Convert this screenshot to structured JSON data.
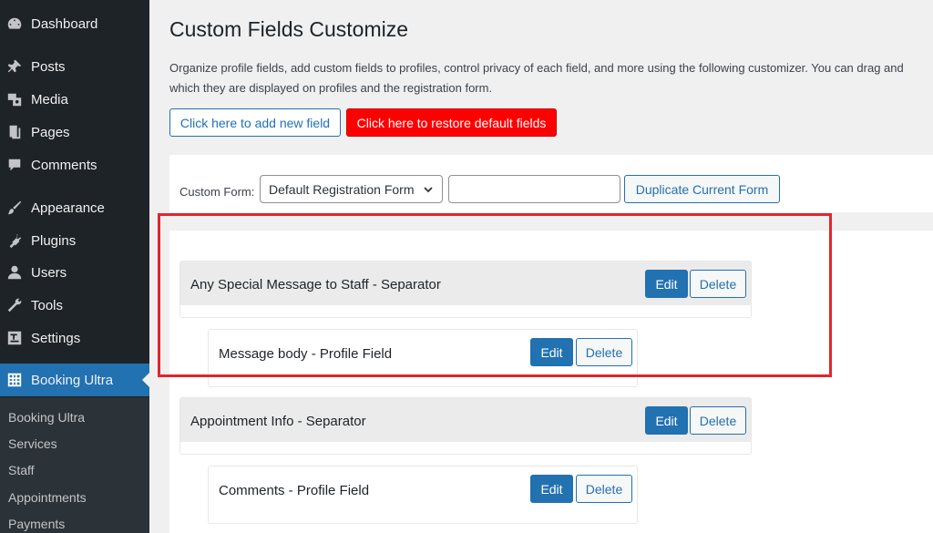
{
  "sidebar": {
    "items": [
      {
        "label": "Dashboard",
        "icon": "dashboard-icon"
      },
      {
        "label": "Posts",
        "icon": "pin-icon"
      },
      {
        "label": "Media",
        "icon": "media-icon"
      },
      {
        "label": "Pages",
        "icon": "pages-icon"
      },
      {
        "label": "Comments",
        "icon": "comment-icon"
      },
      {
        "label": "Appearance",
        "icon": "brush-icon"
      },
      {
        "label": "Plugins",
        "icon": "plug-icon"
      },
      {
        "label": "Users",
        "icon": "user-icon"
      },
      {
        "label": "Tools",
        "icon": "wrench-icon"
      },
      {
        "label": "Settings",
        "icon": "settings-icon"
      }
    ],
    "active": {
      "label": "Booking Ultra",
      "icon": "grid-icon"
    },
    "submenu": [
      "Booking Ultra",
      "Services",
      "Staff",
      "Appointments",
      "Payments"
    ]
  },
  "page": {
    "title": "Custom Fields Customize",
    "description_line1": "Organize profile fields, add custom fields to profiles, control privacy of each field, and more using the following customizer. You can drag and",
    "description_line2": "which they are displayed on profiles and the registration form."
  },
  "actions": {
    "add_field": "Click here to add new field",
    "restore_defaults": "Click here to restore default fields"
  },
  "form": {
    "label": "Custom Form:",
    "selected": "Default Registration Form",
    "name_value": "",
    "duplicate": "Duplicate Current Form"
  },
  "fields": [
    {
      "type": "separator",
      "title": "Any Special Message to Staff - Separator",
      "edit": "Edit",
      "delete": "Delete"
    },
    {
      "type": "field",
      "title": "Message body - Profile Field",
      "edit": "Edit",
      "delete": "Delete"
    },
    {
      "type": "separator",
      "title": "Appointment Info - Separator",
      "edit": "Edit",
      "delete": "Delete"
    },
    {
      "type": "field",
      "title": "Comments - Profile Field",
      "edit": "Edit",
      "delete": "Delete"
    }
  ],
  "colors": {
    "sidebar_bg": "#1d2327",
    "accent": "#2271b1",
    "danger": "#ff0000",
    "highlight": "#e0262c"
  }
}
